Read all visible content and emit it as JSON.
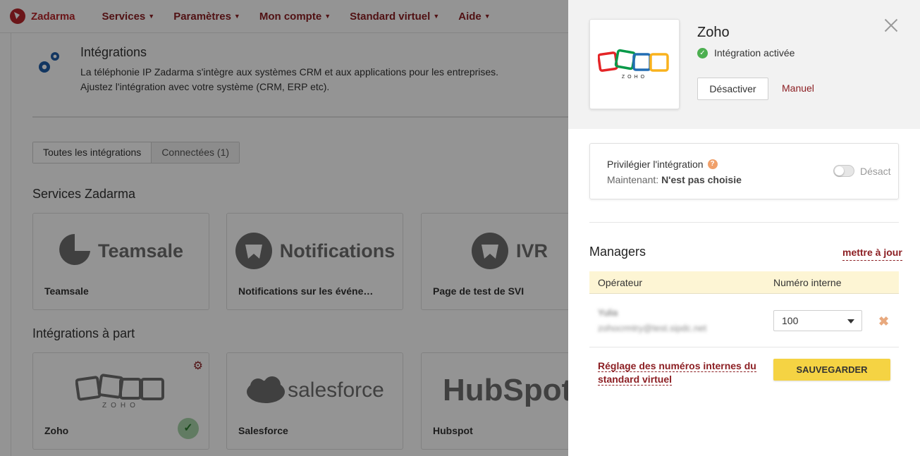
{
  "nav": {
    "logo_text": "Zadarma",
    "items": [
      {
        "label": "Services"
      },
      {
        "label": "Paramètres"
      },
      {
        "label": "Mon compte"
      },
      {
        "label": "Standard virtuel"
      },
      {
        "label": "Aide"
      }
    ]
  },
  "page": {
    "intro_title": "Intégrations",
    "intro_line1": "La téléphonie IP Zadarma s'intègre aux systèmes CRM et aux applications pour les entreprises.",
    "intro_line2": "Ajustez l'intégration avec votre système (CRM, ERP etc).",
    "tabs": [
      {
        "label": "Toutes les intégrations",
        "active": true
      },
      {
        "label": "Connectées (1)",
        "active": false
      }
    ],
    "section1_title": "Services Zadarma",
    "section2_title": "Intégrations à part",
    "service_cards": [
      {
        "logo_text": "Teamsale",
        "name": "Teamsale"
      },
      {
        "logo_text": "Notifications",
        "name": "Notifications sur les événe…"
      },
      {
        "logo_text": "IVR",
        "name": "Page de test de SVI"
      }
    ],
    "integration_cards": [
      {
        "logo_text": "ZOHO",
        "name": "Zoho"
      },
      {
        "logo_text": "salesforce",
        "name": "Salesforce"
      },
      {
        "logo_text": "HubSpot",
        "name": "Hubspot"
      }
    ]
  },
  "drawer": {
    "logo_text": "ZOHO",
    "title": "Zoho",
    "status": "Intégration activée",
    "deactivate_label": "Désactiver",
    "manual_label": "Manuel",
    "priority": {
      "title": "Privilégier l'intégration",
      "help": "?",
      "current_prefix": "Maintenant: ",
      "current_value": "N'est pas choisie",
      "toggle_label": "Désact",
      "toggle_on": false
    },
    "managers": {
      "title": "Managers",
      "update_label": "mettre à jour",
      "columns": [
        "Opérateur",
        "Numéro interne"
      ],
      "rows": [
        {
          "name": "Yulia",
          "email": "zohocrmtry@test.sipdc.net",
          "extension": "100"
        }
      ]
    },
    "footer_link": "Réglage des numéros internes du standard virtuel",
    "save_label": "SAUVEGARDER"
  },
  "colors": {
    "brand": "#8c1f23",
    "accent_yellow": "#f5d343",
    "success": "#4caf50"
  }
}
